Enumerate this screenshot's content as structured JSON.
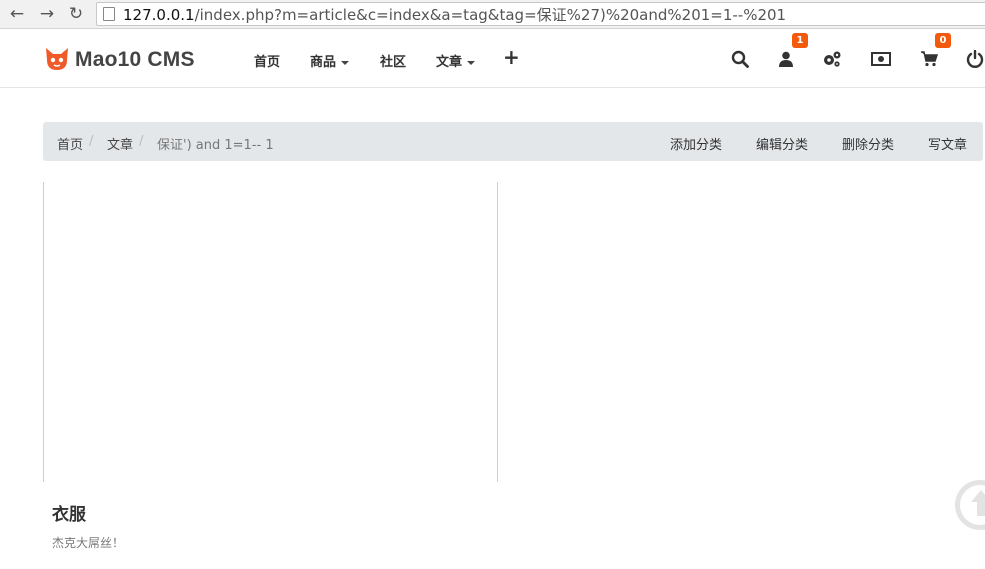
{
  "browser": {
    "url_host": "127.0.0.1",
    "url_path": "/index.php?m=article&c=index&a=tag&tag=保证%27)%20and%201=1--%201"
  },
  "navbar": {
    "brand": "Mao10 CMS",
    "menu": [
      {
        "label": "首页"
      },
      {
        "label": "商品"
      },
      {
        "label": "社区"
      },
      {
        "label": "文章"
      }
    ],
    "user_badge": "1",
    "cart_badge": "0"
  },
  "breadcrumb": {
    "items": [
      "首页",
      "文章",
      "保证') and 1=1-- 1"
    ],
    "separator": "/"
  },
  "actions": [
    "添加分类",
    "编辑分类",
    "删除分类",
    "写文章"
  ],
  "category": {
    "title": "衣服",
    "description": "杰克大屌丝！"
  },
  "colors": {
    "badge": "#f35a0c",
    "logo": "#f05a28",
    "breadcrumb_bg": "#e4e7ea"
  }
}
